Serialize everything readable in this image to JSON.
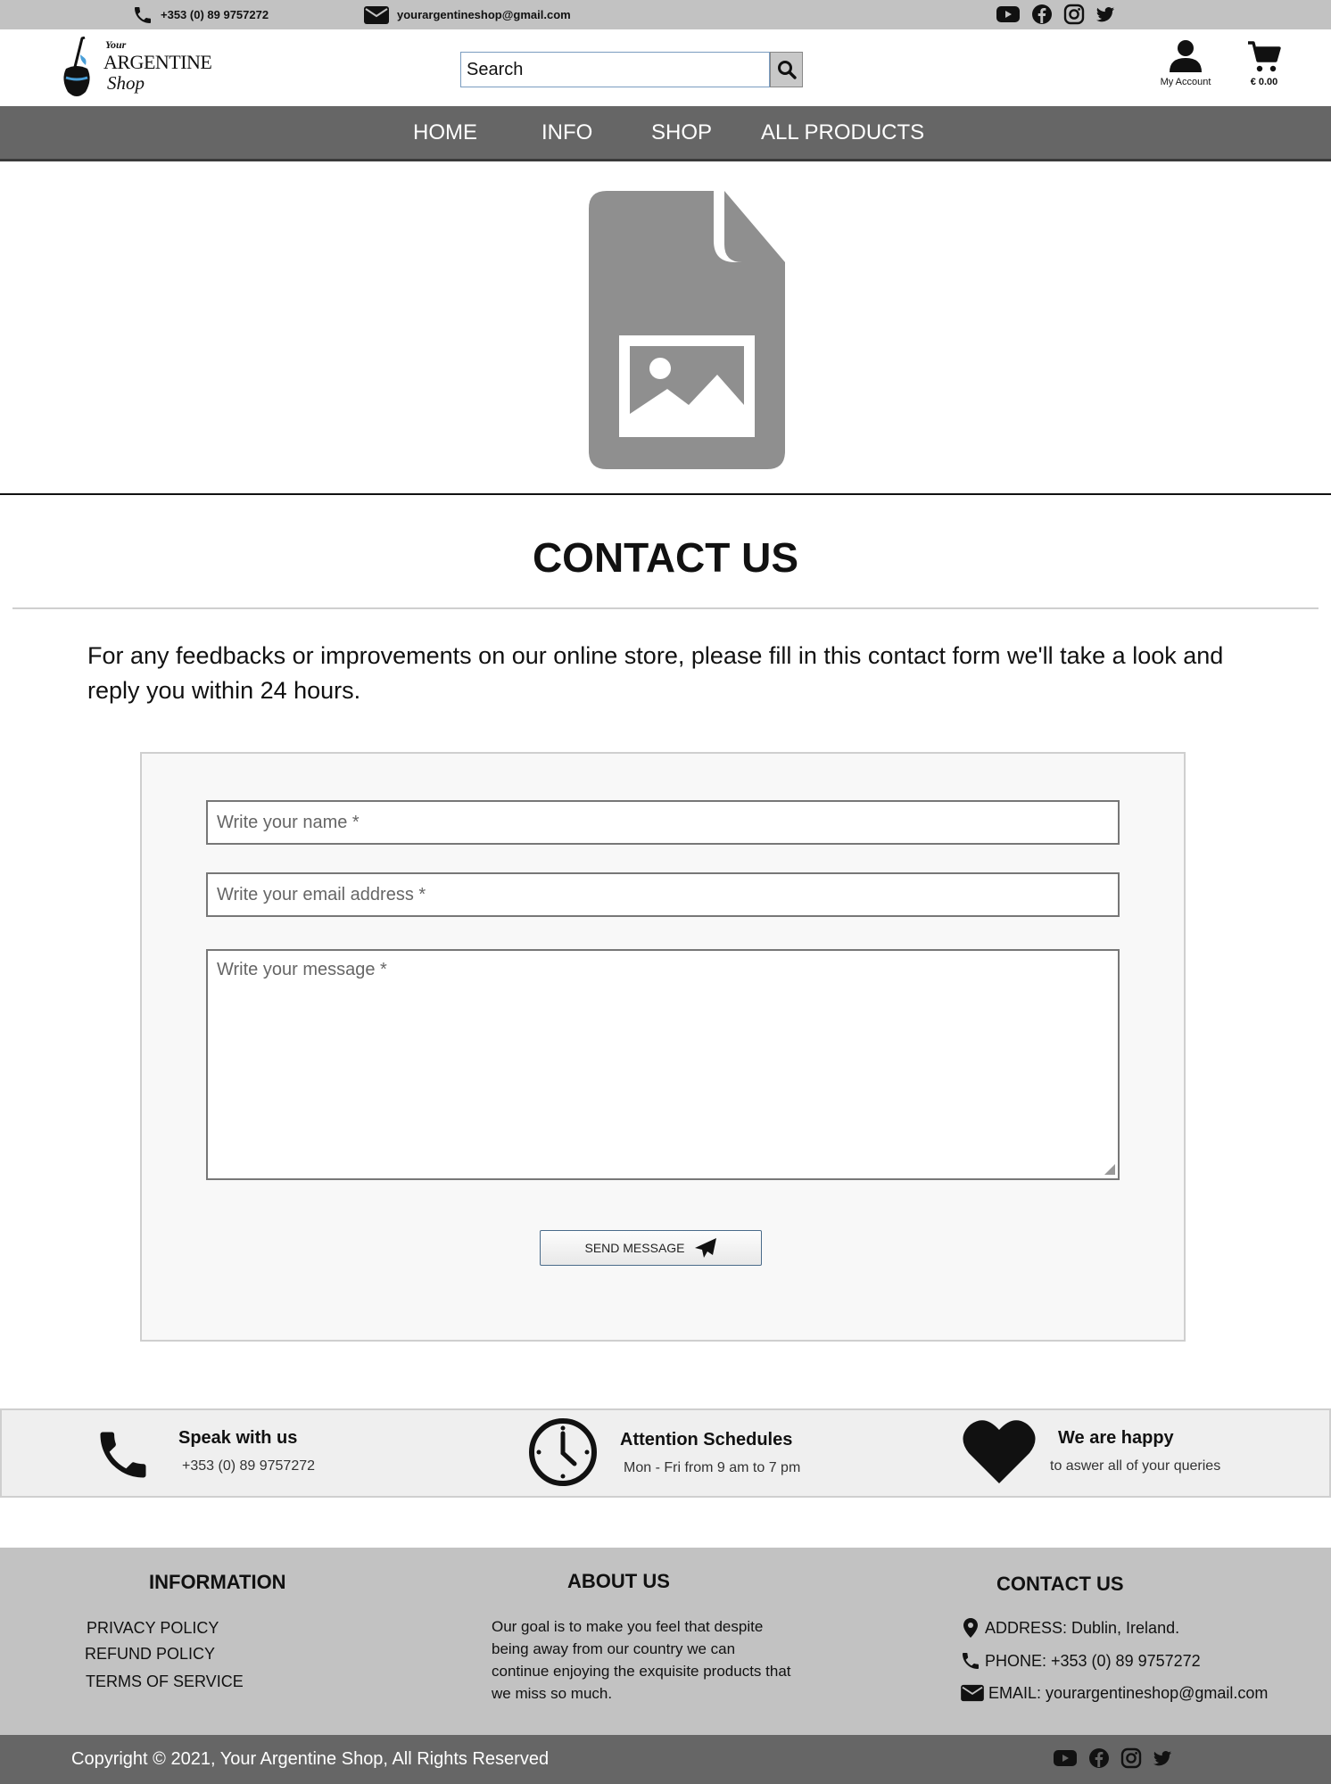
{
  "topbar": {
    "phone": "+353 (0) 89 9757272",
    "email": "yourargentineshop@gmail.com",
    "social_icons": [
      "youtube-icon",
      "facebook-icon",
      "instagram-icon",
      "twitter-icon"
    ]
  },
  "header": {
    "logo": {
      "line1": "Your",
      "line2": "ARGENTINE",
      "line3": "Shop"
    },
    "search_placeholder": "Search",
    "account_label": "My Account",
    "cart_total": "€ 0.00"
  },
  "nav": {
    "items": [
      {
        "label": "HOME"
      },
      {
        "label": "INFO"
      },
      {
        "label": "SHOP"
      },
      {
        "label": "ALL PRODUCTS"
      }
    ]
  },
  "hero": {
    "icon": "image-placeholder-icon"
  },
  "contact": {
    "title": "CONTACT US",
    "intro": "For any feedbacks or improvements on our online store, please fill in this contact form we'll take a look and reply you within 24 hours.",
    "name_placeholder": "Write your name *",
    "email_placeholder": "Write your email address *",
    "message_placeholder": "Write your message *",
    "send_label": "SEND MESSAGE"
  },
  "strip": {
    "speak": {
      "title": "Speak with us",
      "sub": "+353 (0) 89 9757272"
    },
    "schedule": {
      "title": "Attention Schedules",
      "sub": "Mon - Fri from 9 am to 7 pm"
    },
    "happy": {
      "title": "We are happy",
      "sub": "to aswer all of your queries"
    }
  },
  "footer": {
    "information": {
      "heading": "INFORMATION",
      "links": [
        "PRIVACY POLICY",
        "REFUND POLICY",
        "TERMS OF SERVICE"
      ]
    },
    "about": {
      "heading": "ABOUT US",
      "text": "Our goal is to make you feel that despite being away from our country we can continue enjoying the exquisite products that we miss so much."
    },
    "contact": {
      "heading": "CONTACT US",
      "address": "ADDRESS: Dublin, Ireland.",
      "phone": "PHONE: +353 (0) 89 9757272",
      "email": "EMAIL: yourargentineshop@gmail.com"
    },
    "copyright": "Copyright © 2021, Your Argentine Shop, All Rights Reserved"
  },
  "colors": {
    "topbar_bg": "#c2c2c2",
    "nav_bg": "#666666",
    "footer_bg": "#c2c2c2",
    "copybar_bg": "#666666",
    "placeholder_gray": "#8f8f8f",
    "logo_accent": "#4a9fd8"
  }
}
